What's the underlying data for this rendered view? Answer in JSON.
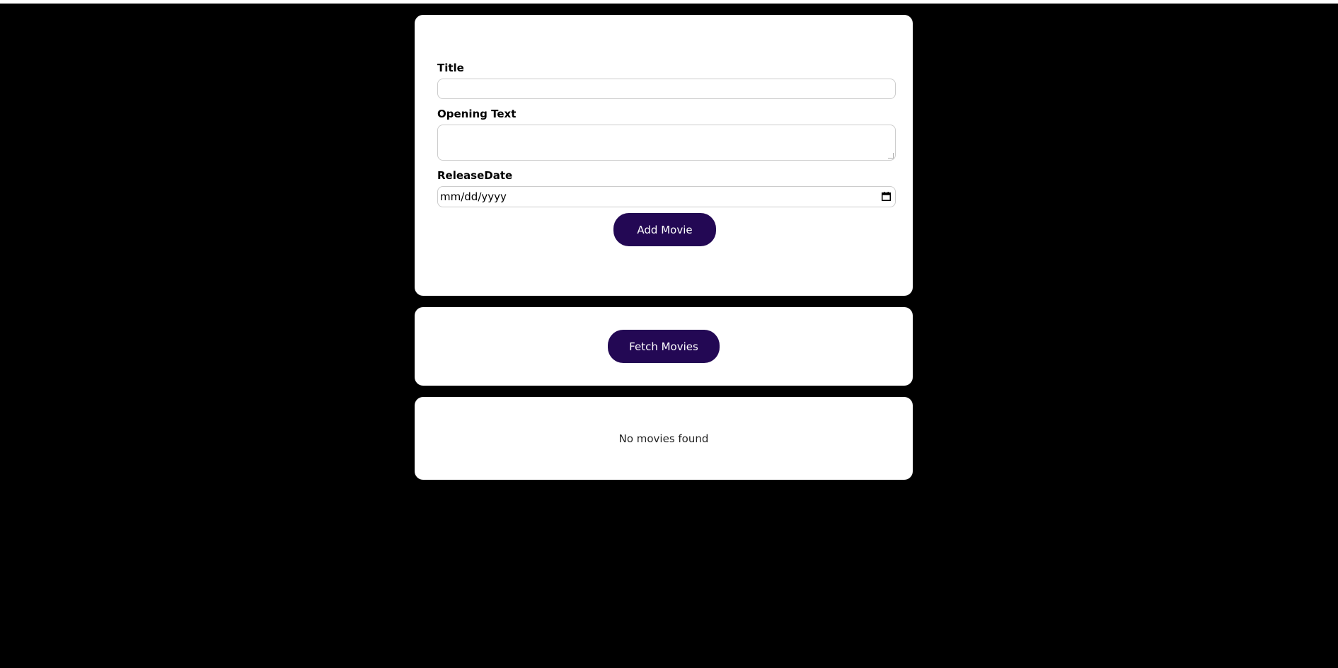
{
  "form": {
    "title_label": "Title",
    "title_value": "",
    "opening_text_label": "Opening Text",
    "opening_text_value": "",
    "release_date_label": "ReleaseDate",
    "release_date_placeholder": "mm/dd/yyyy",
    "add_button_label": "Add Movie"
  },
  "actions": {
    "fetch_button_label": "Fetch Movies"
  },
  "results": {
    "empty_message": "No movies found"
  },
  "theme": {
    "page_background": "#000000",
    "card_background": "#ffffff",
    "button_color": "#230854"
  },
  "icons": {
    "date_picker": "calendar-icon"
  }
}
